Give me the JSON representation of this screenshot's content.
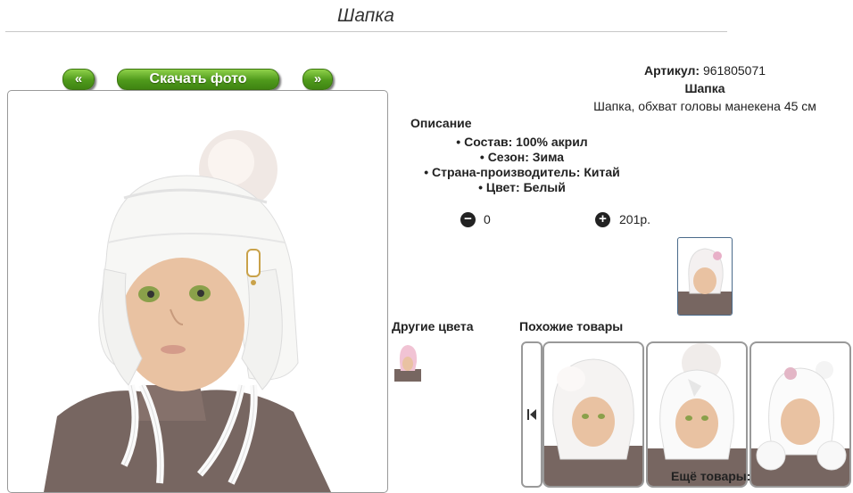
{
  "page": {
    "title": "Шапка"
  },
  "nav": {
    "prev_label": "«",
    "download_label": "Скачать фото",
    "next_label": "»"
  },
  "product": {
    "article_label": "Артикул:",
    "article_value": "961805071",
    "name": "Шапка",
    "subtitle": "Шапка, обхват головы манекена 45 см",
    "description_title": "Описание",
    "specs": [
      "Состав: 100% акрил",
      "Сезон: Зима",
      "Страна-производитель: Китай",
      "Цвет: Белый"
    ],
    "quantity": "0",
    "price": "201р."
  },
  "sections": {
    "other_colors": "Другие цвета",
    "similar": "Похожие товары",
    "more": "Ещё товары:"
  },
  "icons": {
    "minus": "minus-circle-icon",
    "plus": "plus-circle-icon",
    "nav": "first-page-icon"
  },
  "colors": {
    "green": "#4f9a1b",
    "skin": "#e9c2a2",
    "sweater": "#776661"
  }
}
